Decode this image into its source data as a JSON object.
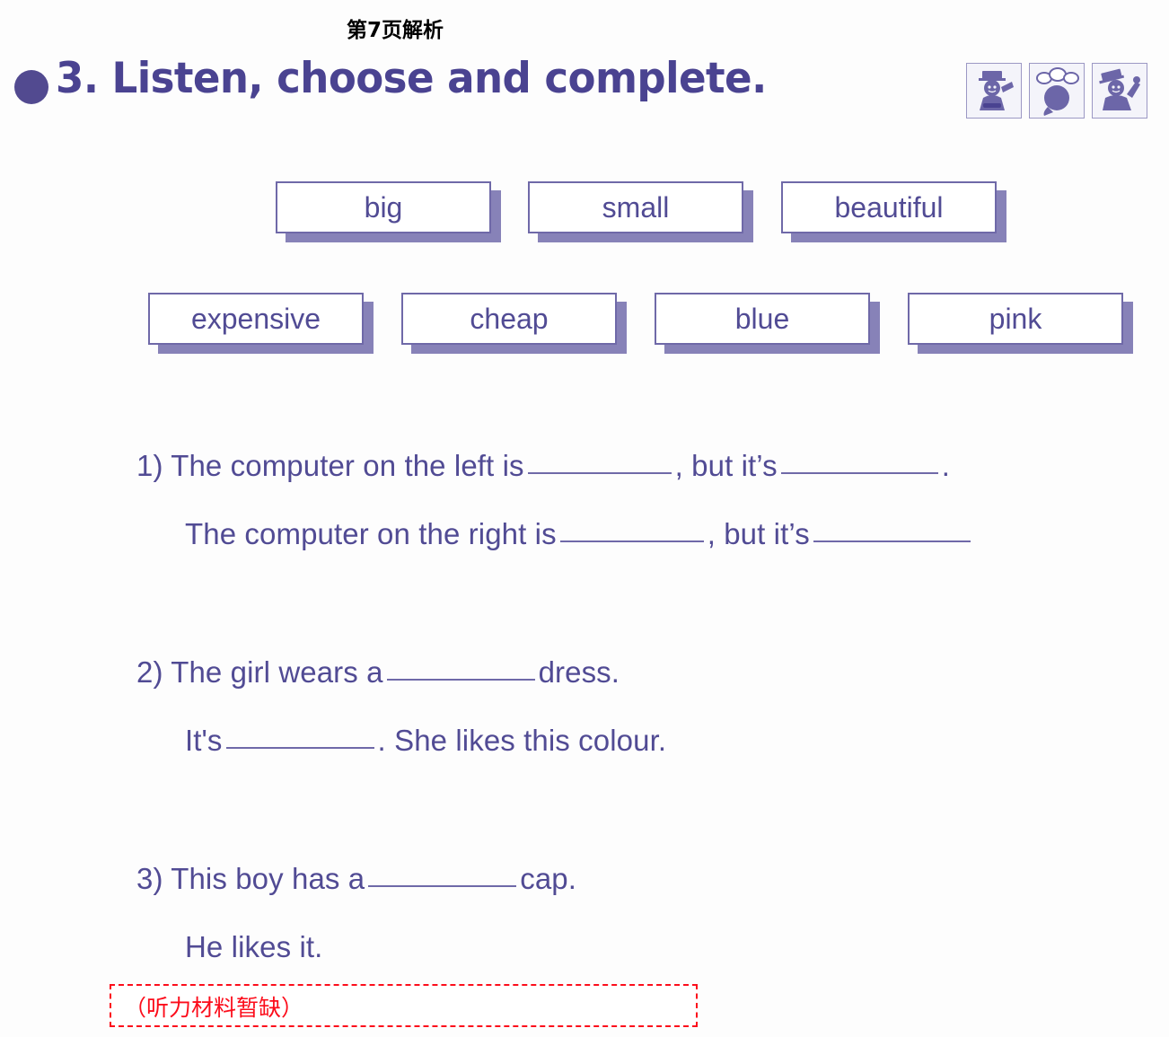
{
  "page": {
    "title": "第7页解析",
    "accent_color": "#514b94",
    "heading_color": "#4a4391",
    "note_color": "#fc0d1b",
    "background_color": "#fdfdfd"
  },
  "exercise": {
    "bullet": "filled-circle",
    "number": "3.",
    "heading": "3. Listen, choose and complete.",
    "icons": [
      {
        "name": "listen-figure-icon",
        "label": "listen"
      },
      {
        "name": "choose-bubbles-icon",
        "label": "choose"
      },
      {
        "name": "complete-figure-icon",
        "label": "complete"
      }
    ]
  },
  "word_bank": {
    "row1": [
      {
        "label": "big"
      },
      {
        "label": "small"
      },
      {
        "label": "beautiful"
      }
    ],
    "row2": [
      {
        "label": "expensive"
      },
      {
        "label": "cheap"
      },
      {
        "label": "blue"
      },
      {
        "label": "pink"
      }
    ]
  },
  "questions": [
    {
      "number": "1)",
      "lines": [
        {
          "pre": "1) The computer on the left is",
          "mid": ", but it’s",
          "post": "."
        },
        {
          "pre": "The computer on the right is",
          "mid": ", but it’s",
          "post": ""
        }
      ]
    },
    {
      "number": "2)",
      "lines": [
        {
          "pre": "2) The girl wears a",
          "mid": "dress.",
          "post": ""
        },
        {
          "pre": "It's",
          "mid": ". She likes this colour.",
          "post": ""
        }
      ]
    },
    {
      "number": "3)",
      "lines": [
        {
          "pre": "3) This boy has a",
          "mid": "cap.",
          "post": ""
        },
        {
          "pre": "He likes it.",
          "mid": "",
          "post": ""
        }
      ]
    }
  ],
  "note": {
    "text": "（听力材料暂缺）"
  }
}
